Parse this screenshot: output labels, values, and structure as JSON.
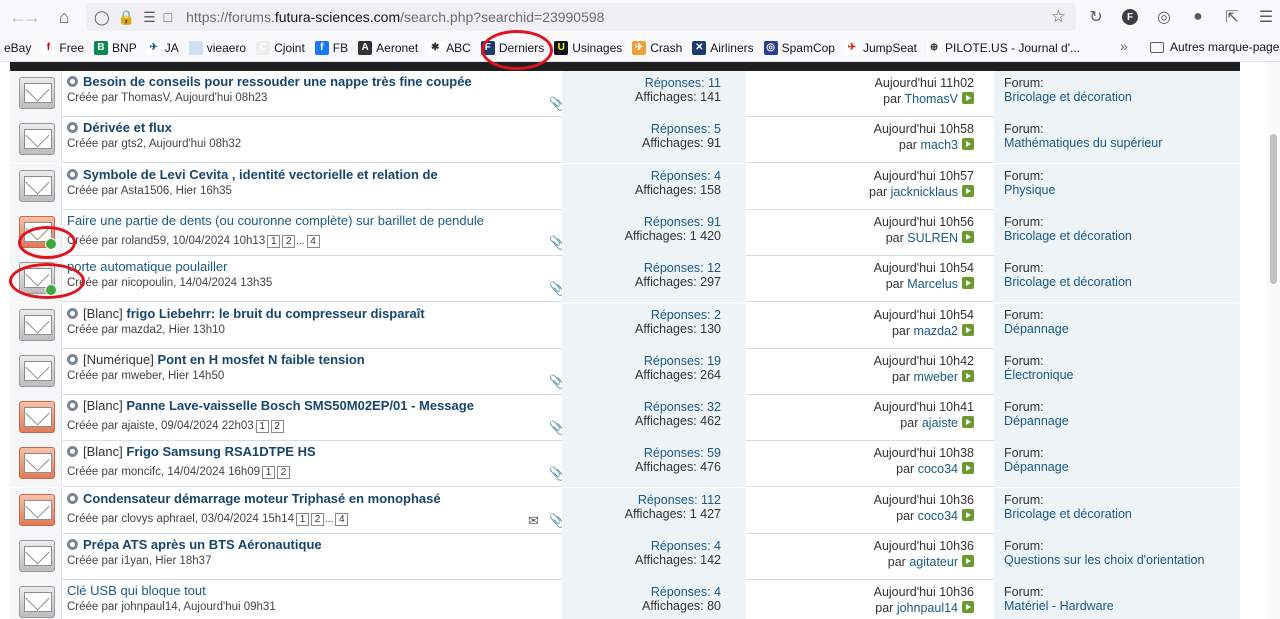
{
  "browser": {
    "url_plain": "https://forums.",
    "url_domain": "futura-sciences.com",
    "url_path": "/search.php?searchid=23990598"
  },
  "bookmarks": [
    {
      "label": "eBay",
      "icon": "ebay-icon"
    },
    {
      "label": "Free",
      "icon": "free-icon"
    },
    {
      "label": "BNP",
      "icon": "bnp-icon"
    },
    {
      "label": "JA",
      "icon": "plane-icon"
    },
    {
      "label": "vieaero",
      "icon": "vieaero-icon"
    },
    {
      "label": "Cjoint",
      "icon": "cjoint-icon"
    },
    {
      "label": "FB",
      "icon": "facebook-icon"
    },
    {
      "label": "Aeronet",
      "icon": "aeronet-icon"
    },
    {
      "label": "ABC",
      "icon": "abc-icon"
    },
    {
      "label": "Derniers",
      "icon": "derniers-icon"
    },
    {
      "label": "Usinages",
      "icon": "usinages-icon"
    },
    {
      "label": "Crash",
      "icon": "crash-icon"
    },
    {
      "label": "Airliners",
      "icon": "airliners-icon"
    },
    {
      "label": "SpamCop",
      "icon": "spamcop-icon"
    },
    {
      "label": "JumpSeat",
      "icon": "jumpseat-icon"
    },
    {
      "label": "PILOTE.US - Journal d'...",
      "icon": "globe-icon"
    }
  ],
  "bookmarks_other": "Autres marque-pages",
  "rows": [
    {
      "hot": false,
      "newdot": false,
      "bullet": true,
      "prefix": "",
      "title": "Besoin de conseils pour ressouder une nappe très fine coupée",
      "bold": true,
      "creator": "Créée par ThomasV, Aujourd'hui 08h23",
      "pages": [],
      "attach": true,
      "replies": "Réponses: 11",
      "views": "Affichages: 141",
      "last_date": "Aujourd'hui 11h02",
      "by": "par",
      "last_user": "ThomasV",
      "forum_label": "Forum:",
      "forum": "Bricolage et décoration"
    },
    {
      "hot": false,
      "newdot": false,
      "bullet": true,
      "prefix": "",
      "title": "Dérivée et flux",
      "bold": true,
      "creator": "Créée par gts2, Aujourd'hui 08h32",
      "pages": [],
      "attach": false,
      "replies": "Réponses: 5",
      "views": "Affichages: 91",
      "last_date": "Aujourd'hui 10h58",
      "by": "par",
      "last_user": "mach3",
      "forum_label": "Forum:",
      "forum": "Mathématiques du supérieur"
    },
    {
      "hot": false,
      "newdot": false,
      "bullet": true,
      "prefix": "",
      "title": "Symbole de Levi Cevita , identité vectorielle et relation de",
      "bold": true,
      "creator": "Créée par Asta1506, Hier 16h35",
      "pages": [],
      "attach": false,
      "replies": "Réponses: 4",
      "views": "Affichages: 158",
      "last_date": "Aujourd'hui 10h57",
      "by": "par",
      "last_user": "jacknicklaus",
      "forum_label": "Forum:",
      "forum": "Physique"
    },
    {
      "hot": true,
      "newdot": true,
      "bullet": false,
      "prefix": "",
      "title": "Faire une partie de dents (ou couronne complète) sur barillet de pendule",
      "bold": false,
      "creator": "Créée par roland59, 10/04/2024 10h13",
      "pages": [
        "1",
        "2",
        "...",
        "4"
      ],
      "attach": true,
      "replies": "Réponses: 91",
      "views": "Affichages: 1 420",
      "last_date": "Aujourd'hui 10h56",
      "by": "par",
      "last_user": "SULREN",
      "forum_label": "Forum:",
      "forum": "Bricolage et décoration"
    },
    {
      "hot": false,
      "newdot": true,
      "bullet": false,
      "prefix": "",
      "title": "porte automatique poulailler",
      "bold": false,
      "creator": "Créée par nicopoulin, 14/04/2024 13h35",
      "pages": [],
      "attach": true,
      "replies": "Réponses: 12",
      "views": "Affichages: 297",
      "last_date": "Aujourd'hui 10h54",
      "by": "par",
      "last_user": "Marcelus",
      "forum_label": "Forum:",
      "forum": "Bricolage et décoration"
    },
    {
      "hot": false,
      "newdot": false,
      "bullet": true,
      "prefix": "[Blanc]",
      "title": "frigo Liebehrr: le bruit du compresseur disparaît",
      "bold": true,
      "creator": "Créée par mazda2, Hier 13h10",
      "pages": [],
      "attach": false,
      "replies": "Réponses: 2",
      "views": "Affichages: 130",
      "last_date": "Aujourd'hui 10h54",
      "by": "par",
      "last_user": "mazda2",
      "forum_label": "Forum:",
      "forum": "Dépannage"
    },
    {
      "hot": false,
      "newdot": false,
      "bullet": true,
      "prefix": "[Numérique]",
      "title": "Pont en H mosfet N faible tension",
      "bold": true,
      "creator": "Créée par mweber, Hier 14h50",
      "pages": [],
      "attach": true,
      "replies": "Réponses: 19",
      "views": "Affichages: 264",
      "last_date": "Aujourd'hui 10h42",
      "by": "par",
      "last_user": "mweber",
      "forum_label": "Forum:",
      "forum": "Électronique"
    },
    {
      "hot": true,
      "newdot": false,
      "bullet": true,
      "prefix": "[Blanc]",
      "title": "Panne Lave-vaisselle Bosch SMS50M02EP/01 - Message",
      "bold": true,
      "creator": "Créée par ajaiste, 09/04/2024 22h03",
      "pages": [
        "1",
        "2"
      ],
      "attach": true,
      "replies": "Réponses: 32",
      "views": "Affichages: 462",
      "last_date": "Aujourd'hui 10h41",
      "by": "par",
      "last_user": "ajaiste",
      "forum_label": "Forum:",
      "forum": "Dépannage"
    },
    {
      "hot": true,
      "newdot": false,
      "bullet": true,
      "prefix": "[Blanc]",
      "title": "Frigo Samsung RSA1DTPE HS",
      "bold": true,
      "creator": "Créée par moncifc, 14/04/2024 16h09",
      "pages": [
        "1",
        "2"
      ],
      "attach": true,
      "replies": "Réponses: 59",
      "views": "Affichages: 476",
      "last_date": "Aujourd'hui 10h38",
      "by": "par",
      "last_user": "coco34",
      "forum_label": "Forum:",
      "forum": "Dépannage"
    },
    {
      "hot": true,
      "newdot": false,
      "bullet": true,
      "prefix": "",
      "title": "Condensateur démarrage moteur Triphasé en monophasé",
      "bold": true,
      "creator": "Créée par clovys aphrael, 03/04/2024 15h14",
      "pages": [
        "1",
        "2",
        "...",
        "4"
      ],
      "attach": true,
      "replies": "Réponses: 112",
      "views": "Affichages: 1 427",
      "last_date": "Aujourd'hui 10h36",
      "by": "par",
      "last_user": "coco34",
      "forum_label": "Forum:",
      "forum": "Bricolage et décoration"
    },
    {
      "hot": false,
      "newdot": false,
      "bullet": true,
      "prefix": "",
      "title": "Prépa ATS après un BTS Aéronautique",
      "bold": true,
      "creator": "Créée par i1yan, Hier 18h37",
      "pages": [],
      "attach": false,
      "replies": "Réponses: 4",
      "views": "Affichages: 142",
      "last_date": "Aujourd'hui 10h36",
      "by": "par",
      "last_user": "agitateur",
      "forum_label": "Forum:",
      "forum": "Questions sur les choix d'orientation"
    },
    {
      "hot": false,
      "newdot": false,
      "bullet": false,
      "prefix": "",
      "title": "Clé USB qui bloque tout",
      "bold": false,
      "creator": "Créée par johnpaul14, Aujourd'hui 09h31",
      "pages": [],
      "attach": false,
      "replies": "Réponses: 4",
      "views": "Affichages: 80",
      "last_date": "Aujourd'hui 10h36",
      "by": "par",
      "last_user": "johnpaul14",
      "forum_label": "Forum:",
      "forum": "Matériel - Hardware"
    }
  ]
}
